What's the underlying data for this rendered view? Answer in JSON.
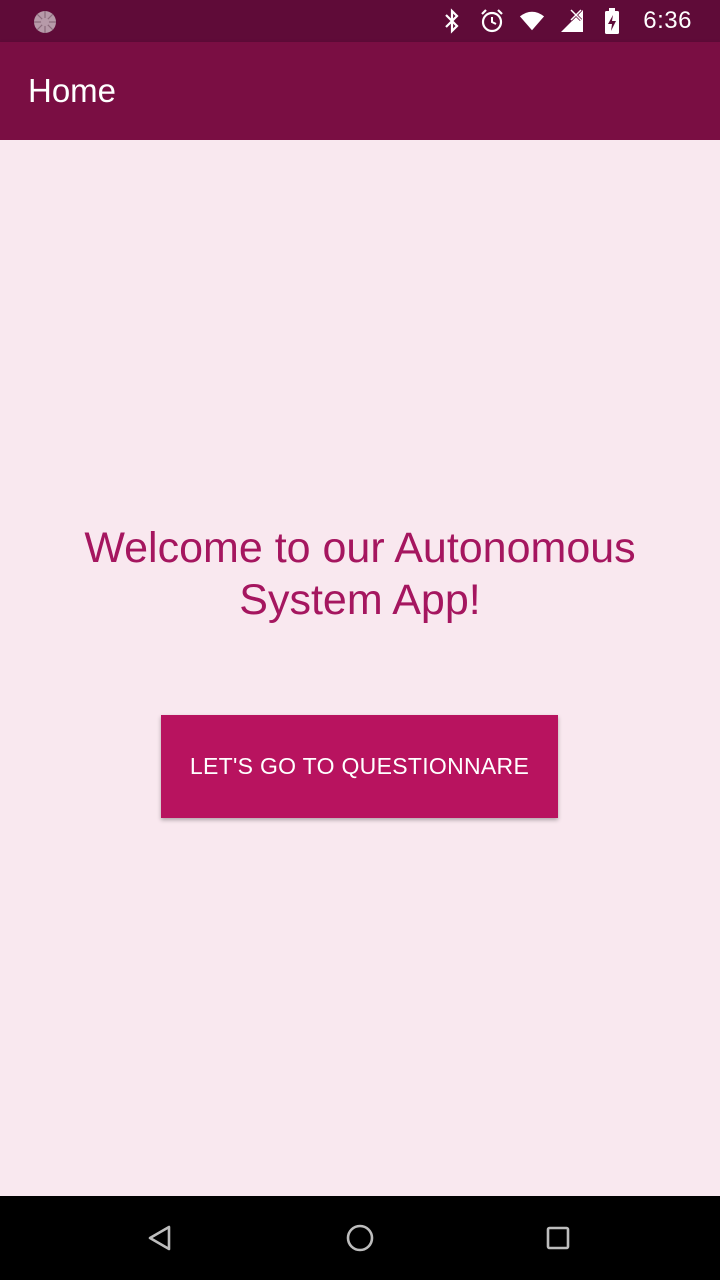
{
  "status_bar": {
    "time": "6:36",
    "icons": [
      "loading-icon",
      "bluetooth-icon",
      "alarm-icon",
      "wifi-icon",
      "no-signal-icon",
      "battery-charging-icon"
    ]
  },
  "app_bar": {
    "title": "Home"
  },
  "main": {
    "welcome_text": "Welcome to our Autonomous System App!",
    "button_label": "LET'S GO TO QUESTIONNARE"
  },
  "nav_bar": {
    "icons": [
      "back-icon",
      "home-icon",
      "recents-icon"
    ]
  },
  "colors": {
    "status_bar": "#5f0b38",
    "app_bar": "#7a0e43",
    "background": "#f9e8ef",
    "accent_text": "#a5165f",
    "button": "#b8135f"
  }
}
